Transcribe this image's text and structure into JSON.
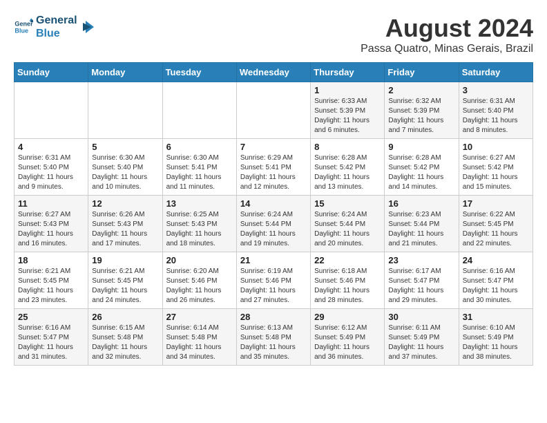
{
  "logo": {
    "line1": "General",
    "line2": "Blue"
  },
  "title": "August 2024",
  "subtitle": "Passa Quatro, Minas Gerais, Brazil",
  "days_of_week": [
    "Sunday",
    "Monday",
    "Tuesday",
    "Wednesday",
    "Thursday",
    "Friday",
    "Saturday"
  ],
  "weeks": [
    [
      {
        "day": "",
        "info": ""
      },
      {
        "day": "",
        "info": ""
      },
      {
        "day": "",
        "info": ""
      },
      {
        "day": "",
        "info": ""
      },
      {
        "day": "1",
        "info": "Sunrise: 6:33 AM\nSunset: 5:39 PM\nDaylight: 11 hours and 6 minutes."
      },
      {
        "day": "2",
        "info": "Sunrise: 6:32 AM\nSunset: 5:39 PM\nDaylight: 11 hours and 7 minutes."
      },
      {
        "day": "3",
        "info": "Sunrise: 6:31 AM\nSunset: 5:40 PM\nDaylight: 11 hours and 8 minutes."
      }
    ],
    [
      {
        "day": "4",
        "info": "Sunrise: 6:31 AM\nSunset: 5:40 PM\nDaylight: 11 hours and 9 minutes."
      },
      {
        "day": "5",
        "info": "Sunrise: 6:30 AM\nSunset: 5:40 PM\nDaylight: 11 hours and 10 minutes."
      },
      {
        "day": "6",
        "info": "Sunrise: 6:30 AM\nSunset: 5:41 PM\nDaylight: 11 hours and 11 minutes."
      },
      {
        "day": "7",
        "info": "Sunrise: 6:29 AM\nSunset: 5:41 PM\nDaylight: 11 hours and 12 minutes."
      },
      {
        "day": "8",
        "info": "Sunrise: 6:28 AM\nSunset: 5:42 PM\nDaylight: 11 hours and 13 minutes."
      },
      {
        "day": "9",
        "info": "Sunrise: 6:28 AM\nSunset: 5:42 PM\nDaylight: 11 hours and 14 minutes."
      },
      {
        "day": "10",
        "info": "Sunrise: 6:27 AM\nSunset: 5:42 PM\nDaylight: 11 hours and 15 minutes."
      }
    ],
    [
      {
        "day": "11",
        "info": "Sunrise: 6:27 AM\nSunset: 5:43 PM\nDaylight: 11 hours and 16 minutes."
      },
      {
        "day": "12",
        "info": "Sunrise: 6:26 AM\nSunset: 5:43 PM\nDaylight: 11 hours and 17 minutes."
      },
      {
        "day": "13",
        "info": "Sunrise: 6:25 AM\nSunset: 5:43 PM\nDaylight: 11 hours and 18 minutes."
      },
      {
        "day": "14",
        "info": "Sunrise: 6:24 AM\nSunset: 5:44 PM\nDaylight: 11 hours and 19 minutes."
      },
      {
        "day": "15",
        "info": "Sunrise: 6:24 AM\nSunset: 5:44 PM\nDaylight: 11 hours and 20 minutes."
      },
      {
        "day": "16",
        "info": "Sunrise: 6:23 AM\nSunset: 5:44 PM\nDaylight: 11 hours and 21 minutes."
      },
      {
        "day": "17",
        "info": "Sunrise: 6:22 AM\nSunset: 5:45 PM\nDaylight: 11 hours and 22 minutes."
      }
    ],
    [
      {
        "day": "18",
        "info": "Sunrise: 6:21 AM\nSunset: 5:45 PM\nDaylight: 11 hours and 23 minutes."
      },
      {
        "day": "19",
        "info": "Sunrise: 6:21 AM\nSunset: 5:45 PM\nDaylight: 11 hours and 24 minutes."
      },
      {
        "day": "20",
        "info": "Sunrise: 6:20 AM\nSunset: 5:46 PM\nDaylight: 11 hours and 26 minutes."
      },
      {
        "day": "21",
        "info": "Sunrise: 6:19 AM\nSunset: 5:46 PM\nDaylight: 11 hours and 27 minutes."
      },
      {
        "day": "22",
        "info": "Sunrise: 6:18 AM\nSunset: 5:46 PM\nDaylight: 11 hours and 28 minutes."
      },
      {
        "day": "23",
        "info": "Sunrise: 6:17 AM\nSunset: 5:47 PM\nDaylight: 11 hours and 29 minutes."
      },
      {
        "day": "24",
        "info": "Sunrise: 6:16 AM\nSunset: 5:47 PM\nDaylight: 11 hours and 30 minutes."
      }
    ],
    [
      {
        "day": "25",
        "info": "Sunrise: 6:16 AM\nSunset: 5:47 PM\nDaylight: 11 hours and 31 minutes."
      },
      {
        "day": "26",
        "info": "Sunrise: 6:15 AM\nSunset: 5:48 PM\nDaylight: 11 hours and 32 minutes."
      },
      {
        "day": "27",
        "info": "Sunrise: 6:14 AM\nSunset: 5:48 PM\nDaylight: 11 hours and 34 minutes."
      },
      {
        "day": "28",
        "info": "Sunrise: 6:13 AM\nSunset: 5:48 PM\nDaylight: 11 hours and 35 minutes."
      },
      {
        "day": "29",
        "info": "Sunrise: 6:12 AM\nSunset: 5:49 PM\nDaylight: 11 hours and 36 minutes."
      },
      {
        "day": "30",
        "info": "Sunrise: 6:11 AM\nSunset: 5:49 PM\nDaylight: 11 hours and 37 minutes."
      },
      {
        "day": "31",
        "info": "Sunrise: 6:10 AM\nSunset: 5:49 PM\nDaylight: 11 hours and 38 minutes."
      }
    ]
  ]
}
